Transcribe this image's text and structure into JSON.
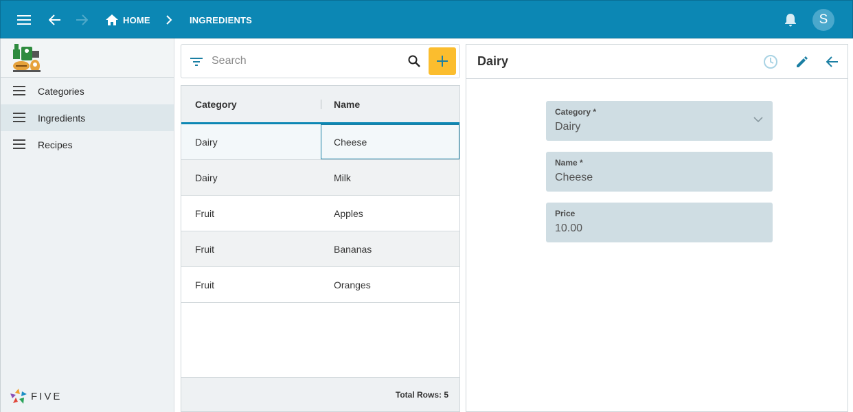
{
  "topbar": {
    "home_label": "HOME",
    "current_label": "INGREDIENTS",
    "avatar_initial": "S",
    "color": "#0c87b4"
  },
  "sidebar": {
    "items": [
      {
        "label": "Categories",
        "icon": "menu-lines-icon",
        "active": false
      },
      {
        "label": "Ingredients",
        "icon": "menu-lines-icon",
        "active": true
      },
      {
        "label": "Recipes",
        "icon": "menu-lines-icon",
        "active": false
      }
    ],
    "brand": "FIVE"
  },
  "search": {
    "placeholder": "Search",
    "value": ""
  },
  "grid": {
    "columns": [
      "Category",
      "Name"
    ],
    "rows": [
      {
        "category": "Dairy",
        "name": "Cheese"
      },
      {
        "category": "Dairy",
        "name": "Milk"
      },
      {
        "category": "Fruit",
        "name": "Apples"
      },
      {
        "category": "Fruit",
        "name": "Bananas"
      },
      {
        "category": "Fruit",
        "name": "Oranges"
      }
    ],
    "footer": "Total Rows: 5"
  },
  "form": {
    "title": "Dairy",
    "fields": [
      {
        "label": "Category *",
        "value": "Dairy"
      },
      {
        "label": "Name *",
        "value": "Cheese"
      },
      {
        "label": "Price",
        "value": "10.00"
      }
    ]
  },
  "colors": {
    "accent": "#0c87b4",
    "add_button": "#fbbd2e",
    "field_bg": "#cfdde3"
  }
}
